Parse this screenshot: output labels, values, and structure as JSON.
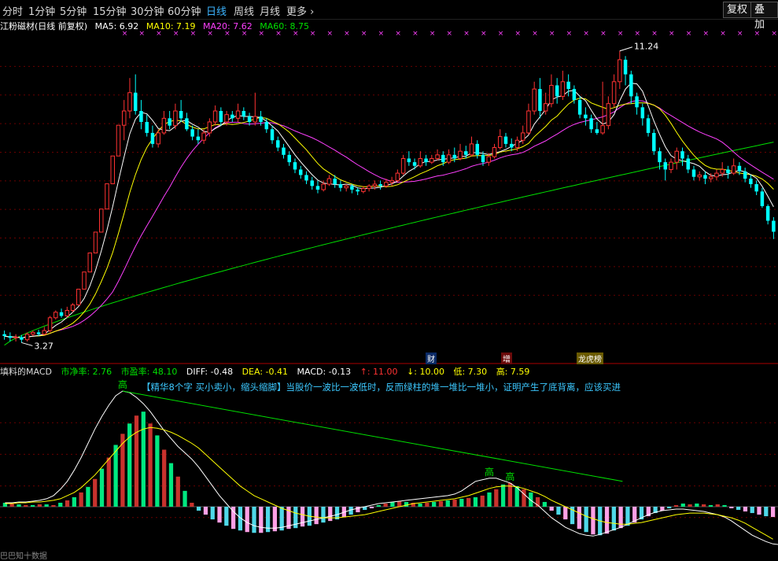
{
  "toolbar": {
    "periods": [
      "分时",
      "1分钟",
      "5分钟",
      "15分钟",
      "30分钟",
      "60分钟",
      "日线",
      "周线",
      "月线"
    ],
    "active_period": "日线",
    "more_label": "更多",
    "more_icon": "chevron-right-icon",
    "restore_label": "复权",
    "overlay_label": "叠加"
  },
  "price_legend": {
    "title": "江粉磁材(日线 前复权)",
    "ma5": "MA5: 6.92",
    "ma10": "MA10: 7.19",
    "ma20": "MA20: 7.62",
    "ma60": "MA60: 8.75",
    "colors": {
      "ma5": "#ffffff",
      "ma10": "#ffff00",
      "ma20": "#ff40ff",
      "ma60": "#00e000",
      "up": "#ff3232",
      "down": "#00ffff"
    }
  },
  "price_annotations": {
    "high": "11.24",
    "low": "3.27"
  },
  "event_flags": [
    "财",
    "增",
    "龙虎榜"
  ],
  "macd_legend": {
    "name": "填料的MACD",
    "pe_net": "市净率: 2.76",
    "pe": "市盈率: 48.10",
    "diff": "DIFF: -0.48",
    "dea": "DEA: -0.41",
    "macd": "MACD: -0.13",
    "up_limit": "↑: 11.00",
    "down_limit": "↓: 10.00",
    "low": "低: 7.30",
    "high": "高: 7.59"
  },
  "macd_note": "【精华8个字 买小卖小，缩头缩脚】当股价一波比一波低时，反而绿柱的堆一堆比一堆小，证明产生了底背离，应该买进",
  "macd_marks": [
    "高",
    "高",
    "高"
  ],
  "status_text": "巴巴知十数据",
  "chart_data": {
    "type": "candlestick",
    "candles": [
      [
        3.5,
        3.45,
        3.6,
        3.35
      ],
      [
        3.45,
        3.4,
        3.55,
        3.3
      ],
      [
        3.4,
        3.42,
        3.5,
        3.3
      ],
      [
        3.42,
        3.35,
        3.48,
        3.27
      ],
      [
        3.35,
        3.5,
        3.55,
        3.3
      ],
      [
        3.5,
        3.55,
        3.6,
        3.45
      ],
      [
        3.55,
        3.5,
        3.62,
        3.45
      ],
      [
        3.5,
        3.6,
        3.7,
        3.48
      ],
      [
        3.6,
        3.95,
        4.0,
        3.55
      ],
      [
        3.95,
        4.1,
        4.15,
        3.9
      ],
      [
        4.1,
        4.0,
        4.2,
        3.95
      ],
      [
        4.0,
        4.15,
        4.25,
        3.95
      ],
      [
        4.15,
        4.3,
        4.35,
        4.1
      ],
      [
        4.3,
        4.73,
        4.73,
        4.73
      ],
      [
        4.73,
        5.2,
        5.2,
        5.2
      ],
      [
        5.2,
        5.72,
        5.72,
        5.72
      ],
      [
        5.72,
        6.29,
        6.29,
        6.29
      ],
      [
        6.29,
        6.92,
        6.92,
        6.92
      ],
      [
        6.92,
        7.61,
        7.61,
        7.61
      ],
      [
        7.61,
        8.37,
        8.37,
        8.37
      ],
      [
        8.37,
        9.21,
        9.21,
        9.21
      ],
      [
        9.21,
        9.6,
        9.9,
        8.8
      ],
      [
        9.6,
        10.1,
        10.5,
        9.4
      ],
      [
        10.1,
        9.6,
        10.6,
        9.5
      ],
      [
        9.6,
        9.3,
        9.9,
        9.1
      ],
      [
        9.3,
        9.0,
        9.5,
        8.9
      ],
      [
        9.0,
        8.7,
        9.2,
        8.6
      ],
      [
        8.7,
        9.0,
        9.1,
        8.6
      ],
      [
        9.0,
        9.4,
        9.6,
        8.95
      ],
      [
        9.4,
        9.2,
        9.6,
        9.1
      ],
      [
        9.2,
        9.6,
        9.8,
        9.1
      ],
      [
        9.6,
        9.4,
        9.9,
        9.3
      ],
      [
        9.4,
        9.1,
        9.55,
        9.05
      ],
      [
        9.1,
        8.9,
        9.2,
        8.8
      ],
      [
        8.9,
        8.8,
        9.1,
        8.7
      ],
      [
        8.8,
        9.0,
        9.1,
        8.7
      ],
      [
        9.0,
        9.3,
        9.4,
        8.9
      ],
      [
        9.3,
        9.6,
        9.75,
        9.2
      ],
      [
        9.6,
        9.3,
        9.7,
        9.2
      ],
      [
        9.3,
        9.5,
        9.6,
        9.2
      ],
      [
        9.5,
        9.4,
        9.6,
        9.3
      ],
      [
        9.4,
        9.6,
        9.8,
        9.3
      ],
      [
        9.6,
        9.45,
        9.7,
        9.35
      ],
      [
        9.45,
        9.3,
        9.55,
        9.2
      ],
      [
        9.3,
        9.45,
        10.1,
        9.2
      ],
      [
        9.45,
        9.3,
        9.6,
        9.2
      ],
      [
        9.3,
        9.1,
        9.4,
        9.0
      ],
      [
        9.1,
        8.8,
        9.2,
        8.7
      ],
      [
        8.8,
        8.6,
        8.9,
        8.5
      ],
      [
        8.6,
        8.4,
        8.7,
        8.3
      ],
      [
        8.4,
        8.2,
        8.5,
        8.1
      ],
      [
        8.2,
        8.0,
        8.3,
        7.9
      ],
      [
        8.0,
        7.85,
        8.1,
        7.75
      ],
      [
        7.85,
        7.7,
        7.95,
        7.6
      ],
      [
        7.7,
        7.55,
        7.8,
        7.45
      ],
      [
        7.55,
        7.45,
        7.7,
        7.35
      ],
      [
        7.45,
        7.6,
        7.7,
        7.4
      ],
      [
        7.6,
        7.75,
        7.85,
        7.55
      ],
      [
        7.75,
        7.6,
        7.85,
        7.5
      ],
      [
        7.6,
        7.5,
        7.7,
        7.4
      ],
      [
        7.5,
        7.55,
        7.6,
        7.4
      ],
      [
        7.55,
        7.45,
        7.6,
        7.35
      ],
      [
        7.45,
        7.4,
        7.5,
        7.3
      ],
      [
        7.4,
        7.48,
        7.55,
        7.35
      ],
      [
        7.48,
        7.55,
        7.6,
        7.4
      ],
      [
        7.55,
        7.6,
        7.7,
        7.45
      ],
      [
        7.6,
        7.55,
        7.7,
        7.45
      ],
      [
        7.55,
        7.65,
        7.75,
        7.5
      ],
      [
        7.65,
        7.7,
        7.8,
        7.55
      ],
      [
        7.7,
        7.9,
        8.0,
        7.65
      ],
      [
        7.9,
        8.3,
        8.4,
        7.85
      ],
      [
        8.3,
        8.2,
        8.5,
        8.1
      ],
      [
        8.2,
        8.1,
        8.3,
        8.0
      ],
      [
        8.1,
        8.3,
        8.5,
        8.05
      ],
      [
        8.3,
        8.2,
        8.4,
        8.1
      ],
      [
        8.2,
        8.3,
        8.4,
        8.15
      ],
      [
        8.3,
        8.4,
        8.55,
        8.25
      ],
      [
        8.4,
        8.2,
        8.5,
        8.1
      ],
      [
        8.2,
        8.4,
        8.55,
        8.15
      ],
      [
        8.4,
        8.3,
        8.6,
        8.2
      ],
      [
        8.3,
        8.5,
        8.7,
        8.25
      ],
      [
        8.5,
        8.4,
        8.65,
        8.3
      ],
      [
        8.4,
        8.7,
        8.9,
        8.35
      ],
      [
        8.7,
        8.4,
        8.8,
        8.3
      ],
      [
        8.4,
        8.2,
        8.5,
        8.1
      ],
      [
        8.2,
        8.35,
        8.45,
        8.1
      ],
      [
        8.35,
        8.6,
        8.7,
        8.3
      ],
      [
        8.6,
        8.9,
        9.1,
        8.55
      ],
      [
        8.9,
        8.7,
        9.0,
        8.6
      ],
      [
        8.7,
        8.6,
        8.85,
        8.5
      ],
      [
        8.6,
        8.8,
        8.9,
        8.5
      ],
      [
        8.8,
        9.0,
        9.2,
        8.7
      ],
      [
        9.0,
        9.6,
        9.8,
        8.95
      ],
      [
        9.6,
        10.2,
        10.4,
        9.5
      ],
      [
        10.2,
        9.6,
        10.5,
        9.4
      ],
      [
        9.6,
        9.8,
        10.1,
        9.5
      ],
      [
        9.8,
        10.3,
        10.6,
        9.7
      ],
      [
        10.3,
        10.0,
        10.5,
        9.8
      ],
      [
        10.0,
        10.4,
        10.7,
        9.9
      ],
      [
        10.4,
        10.2,
        10.6,
        10.0
      ],
      [
        10.2,
        9.9,
        10.3,
        9.8
      ],
      [
        9.9,
        9.5,
        10.0,
        9.4
      ],
      [
        9.5,
        9.4,
        9.7,
        9.2
      ],
      [
        9.4,
        9.1,
        9.5,
        9.0
      ],
      [
        9.1,
        9.0,
        9.3,
        8.95
      ],
      [
        9.0,
        9.2,
        10.4,
        8.95
      ],
      [
        9.2,
        9.8,
        10.0,
        9.1
      ],
      [
        9.8,
        10.4,
        10.6,
        9.7
      ],
      [
        10.4,
        11.0,
        11.24,
        10.2
      ],
      [
        11.0,
        10.6,
        11.1,
        10.3
      ],
      [
        10.6,
        10.0,
        10.7,
        9.8
      ],
      [
        10.0,
        9.7,
        10.1,
        9.5
      ],
      [
        9.7,
        9.4,
        9.8,
        9.2
      ],
      [
        9.4,
        9.0,
        9.5,
        8.9
      ],
      [
        9.0,
        8.5,
        9.1,
        8.4
      ],
      [
        8.5,
        8.2,
        8.6,
        8.0
      ],
      [
        8.2,
        8.0,
        8.3,
        7.7
      ],
      [
        8.0,
        8.2,
        8.3,
        7.9
      ],
      [
        8.2,
        8.5,
        8.6,
        8.0
      ],
      [
        8.5,
        8.3,
        8.6,
        8.1
      ],
      [
        8.3,
        8.0,
        8.4,
        7.9
      ],
      [
        8.0,
        7.8,
        8.1,
        7.7
      ],
      [
        7.8,
        7.85,
        7.95,
        7.7
      ],
      [
        7.85,
        7.75,
        7.95,
        7.6
      ],
      [
        7.75,
        7.8,
        7.9,
        7.65
      ],
      [
        7.8,
        7.9,
        8.0,
        7.7
      ],
      [
        7.9,
        8.0,
        8.2,
        7.8
      ],
      [
        8.0,
        7.9,
        8.1,
        7.75
      ],
      [
        7.9,
        8.1,
        8.3,
        7.85
      ],
      [
        8.1,
        7.95,
        8.2,
        7.85
      ],
      [
        7.95,
        7.75,
        8.05,
        7.65
      ],
      [
        7.75,
        7.6,
        7.85,
        7.5
      ],
      [
        7.6,
        7.4,
        7.7,
        7.3
      ],
      [
        7.4,
        7.0,
        7.5,
        6.95
      ],
      [
        7.0,
        6.6,
        7.05,
        6.5
      ],
      [
        6.6,
        6.3,
        6.7,
        6.1
      ]
    ],
    "ma60_start": 3.2,
    "ma60_end": 8.75,
    "ylim": [
      3.0,
      11.6
    ],
    "macd": {
      "histogram": [
        0.05,
        0.04,
        0.03,
        0.02,
        0.02,
        0.03,
        0.03,
        0.02,
        0.05,
        0.08,
        0.12,
        0.18,
        0.25,
        0.35,
        0.48,
        0.62,
        0.78,
        0.92,
        1.05,
        1.15,
        1.2,
        1.05,
        0.9,
        0.72,
        0.55,
        0.38,
        0.2,
        0.05,
        -0.05,
        -0.1,
        -0.16,
        -0.2,
        -0.24,
        -0.28,
        -0.3,
        -0.32,
        -0.33,
        -0.33,
        -0.32,
        -0.31,
        -0.3,
        -0.28,
        -0.27,
        -0.25,
        -0.24,
        -0.22,
        -0.2,
        -0.18,
        -0.16,
        -0.13,
        -0.1,
        -0.07,
        -0.04,
        -0.02,
        0.02,
        0.04,
        0.06,
        0.07,
        0.06,
        0.05,
        0.04,
        0.05,
        0.06,
        0.07,
        0.08,
        0.09,
        0.1,
        0.11,
        0.12,
        0.14,
        0.18,
        0.22,
        0.28,
        0.3,
        0.26,
        0.22,
        0.18,
        0.12,
        0.06,
        -0.05,
        -0.1,
        -0.16,
        -0.22,
        -0.28,
        -0.32,
        -0.35,
        -0.36,
        -0.34,
        -0.3,
        -0.27,
        -0.24,
        -0.2,
        -0.16,
        -0.12,
        -0.08,
        -0.05,
        -0.02,
        0.02,
        0.04,
        0.03,
        0.04,
        0.03,
        0.02,
        0.03,
        0.02,
        -0.02,
        -0.04,
        -0.06,
        -0.08,
        -0.1,
        -0.12,
        -0.13
      ],
      "diff": [
        0.05,
        0.05,
        0.06,
        0.06,
        0.07,
        0.08,
        0.1,
        0.14,
        0.22,
        0.32,
        0.46,
        0.62,
        0.8,
        0.98,
        1.14,
        1.28,
        1.4,
        1.46,
        1.44,
        1.38,
        1.3,
        1.2,
        1.08,
        0.96,
        0.86,
        0.76,
        0.68,
        0.6,
        0.5,
        0.38,
        0.26,
        0.14,
        0.04,
        -0.06,
        -0.14,
        -0.2,
        -0.24,
        -0.26,
        -0.27,
        -0.27,
        -0.26,
        -0.24,
        -0.22,
        -0.2,
        -0.18,
        -0.16,
        -0.14,
        -0.12,
        -0.1,
        -0.07,
        -0.04,
        -0.02,
        0.0,
        0.02,
        0.04,
        0.05,
        0.06,
        0.07,
        0.08,
        0.09,
        0.1,
        0.11,
        0.12,
        0.13,
        0.14,
        0.16,
        0.2,
        0.26,
        0.32,
        0.34,
        0.36,
        0.36,
        0.33,
        0.3,
        0.24,
        0.16,
        0.08,
        0.02,
        -0.06,
        -0.14,
        -0.2,
        -0.26,
        -0.3,
        -0.34,
        -0.36,
        -0.37,
        -0.35,
        -0.32,
        -0.29,
        -0.26,
        -0.22,
        -0.18,
        -0.14,
        -0.1,
        -0.07,
        -0.05,
        -0.04,
        -0.03,
        -0.03,
        -0.04,
        -0.05,
        -0.06,
        -0.08,
        -0.1,
        -0.13,
        -0.18,
        -0.24,
        -0.3,
        -0.36,
        -0.4,
        -0.44,
        -0.47,
        -0.48
      ],
      "dea": [
        0.04,
        0.04,
        0.05,
        0.05,
        0.06,
        0.06,
        0.07,
        0.08,
        0.1,
        0.14,
        0.18,
        0.24,
        0.32,
        0.4,
        0.5,
        0.6,
        0.7,
        0.8,
        0.88,
        0.94,
        0.98,
        1.0,
        0.99,
        0.97,
        0.94,
        0.9,
        0.85,
        0.8,
        0.74,
        0.66,
        0.58,
        0.5,
        0.42,
        0.34,
        0.26,
        0.2,
        0.14,
        0.1,
        0.06,
        0.02,
        -0.02,
        -0.05,
        -0.08,
        -0.1,
        -0.12,
        -0.13,
        -0.14,
        -0.14,
        -0.14,
        -0.13,
        -0.12,
        -0.11,
        -0.1,
        -0.08,
        -0.06,
        -0.04,
        -0.02,
        0.0,
        0.02,
        0.04,
        0.05,
        0.06,
        0.07,
        0.08,
        0.09,
        0.1,
        0.12,
        0.14,
        0.17,
        0.2,
        0.23,
        0.25,
        0.26,
        0.26,
        0.25,
        0.23,
        0.2,
        0.17,
        0.13,
        0.08,
        0.04,
        0.0,
        -0.04,
        -0.08,
        -0.12,
        -0.15,
        -0.18,
        -0.2,
        -0.21,
        -0.22,
        -0.22,
        -0.21,
        -0.2,
        -0.18,
        -0.16,
        -0.14,
        -0.12,
        -0.1,
        -0.09,
        -0.08,
        -0.08,
        -0.08,
        -0.09,
        -0.1,
        -0.12,
        -0.14,
        -0.17,
        -0.21,
        -0.26,
        -0.31,
        -0.36,
        -0.41
      ]
    }
  }
}
